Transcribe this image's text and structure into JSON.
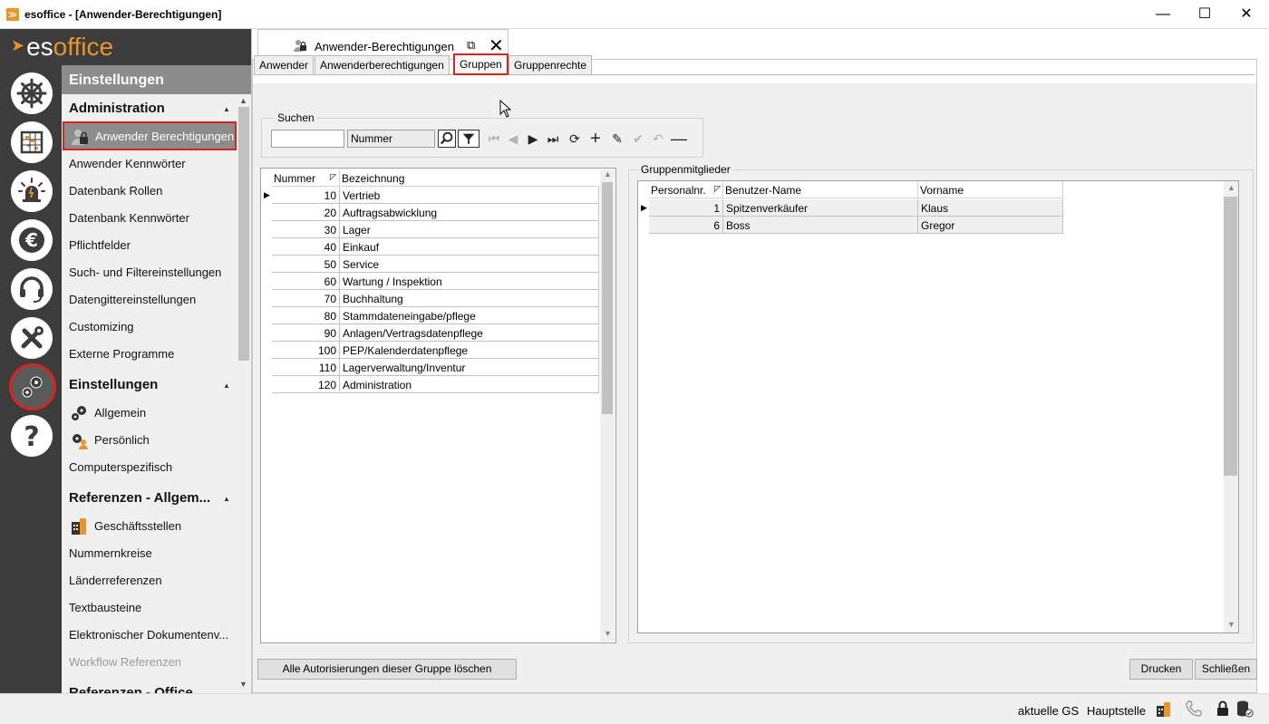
{
  "window": {
    "title": "esoffice - [Anwender-Berechtigungen]",
    "minimize_glyph": "—",
    "maximize_glyph": "☐",
    "close_glyph": "✕"
  },
  "brand": {
    "part1": "es",
    "part2": "office"
  },
  "rail": {
    "buttons": [
      {
        "name": "ship-wheel-icon"
      },
      {
        "name": "planner-icon"
      },
      {
        "name": "alarm-light-icon"
      },
      {
        "name": "euro-icon"
      },
      {
        "name": "headset-icon"
      },
      {
        "name": "tools-icon"
      },
      {
        "name": "gears-icon",
        "active": true
      },
      {
        "name": "help-icon"
      }
    ]
  },
  "nav": {
    "header": "Einstellungen",
    "groups": {
      "administration": "Administration",
      "einstellungen": "Einstellungen",
      "referenzen_allgemein": "Referenzen - Allgem...",
      "referenzen_office": "Referenzen - Office"
    },
    "items": {
      "anwender_berechtigungen": "Anwender Berechtigungen",
      "anwender_kennwoerter": "Anwender Kennwörter",
      "datenbank_rollen": "Datenbank Rollen",
      "datenbank_kennwoerter": "Datenbank Kennwörter",
      "pflichtfelder": "Pflichtfelder",
      "such_filter": "Such- und Filtereinstellungen",
      "datengitter": "Datengittereinstellungen",
      "customizing": "Customizing",
      "externe_programme": "Externe Programme",
      "allgemein": "Allgemein",
      "persoenlich": "Persönlich",
      "computerspezifisch": "Computerspezifisch",
      "geschaeftsstellen": "Geschäftsstellen",
      "nummernkreise": "Nummernkreise",
      "laenderreferenzen": "Länderreferenzen",
      "textbausteine": "Textbausteine",
      "elektronischer_dok": "Elektronischer Dokumentenv...",
      "workflow_referenzen": "Workflow Referenzen"
    }
  },
  "doctab": {
    "label": "Anwender-Berechtigungen",
    "popout_glyph": "⧉",
    "close_glyph": "✕"
  },
  "subtabs": [
    "Anwender",
    "Anwenderberechtigungen",
    "Gruppen",
    "Gruppenrechte"
  ],
  "search": {
    "group_label": "Suchen",
    "value": "",
    "field": "Nummer"
  },
  "groups_grid": {
    "columns": [
      "Nummer",
      "Bezeichnung"
    ],
    "rows": [
      {
        "nummer": "10",
        "bezeichnung": "Vertrieb"
      },
      {
        "nummer": "20",
        "bezeichnung": "Auftragsabwicklung"
      },
      {
        "nummer": "30",
        "bezeichnung": "Lager"
      },
      {
        "nummer": "40",
        "bezeichnung": "Einkauf"
      },
      {
        "nummer": "50",
        "bezeichnung": "Service"
      },
      {
        "nummer": "60",
        "bezeichnung": "Wartung / Inspektion"
      },
      {
        "nummer": "70",
        "bezeichnung": "Buchhaltung"
      },
      {
        "nummer": "80",
        "bezeichnung": "Stammdateneingabe/pflege"
      },
      {
        "nummer": "90",
        "bezeichnung": "Anlagen/Vertragsdatenpflege"
      },
      {
        "nummer": "100",
        "bezeichnung": "PEP/Kalenderdatenpflege"
      },
      {
        "nummer": "110",
        "bezeichnung": "Lagerverwaltung/Inventur"
      },
      {
        "nummer": "120",
        "bezeichnung": "Administration"
      }
    ]
  },
  "members": {
    "group_label": "Gruppenmitglieder",
    "columns": [
      "Personalnr.",
      "Benutzer-Name",
      "Vorname"
    ],
    "rows": [
      {
        "personalnr": "1",
        "benutzer": "Spitzenverkäufer",
        "vorname": "Klaus"
      },
      {
        "personalnr": "6",
        "benutzer": "Boss",
        "vorname": "Gregor"
      }
    ]
  },
  "buttons": {
    "delete_all": "Alle Autorisierungen dieser Gruppe löschen",
    "print": "Drucken",
    "close": "Schließen"
  },
  "status": {
    "gs_label": "aktuelle GS",
    "branch": "Hauptstelle"
  },
  "colors": {
    "accent_orange": "#e8962c",
    "highlight_red": "#d9231f",
    "rail_dark": "#3c3c3c",
    "nav_header_gray": "#8c8c8c"
  }
}
